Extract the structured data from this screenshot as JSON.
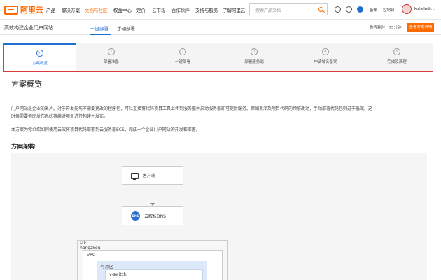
{
  "header": {
    "logo_text": "阿里云",
    "nav": [
      "产品",
      "解决方案",
      "文档与社区",
      "权益中心",
      "定价",
      "云市场",
      "合作伙伴",
      "支持与服务",
      "了解阿里云"
    ],
    "nav_active_index": 2,
    "search_placeholder": "搜索产品文档",
    "links": [
      "备案",
      "控制台"
    ],
    "username": "kohelp@..."
  },
  "subheader": {
    "title": "高效构建企业门户网站",
    "tabs": [
      "一键部署",
      "手动部署"
    ],
    "active_tab": 0,
    "time_label": "教程耗时：75分钟",
    "deploy_button": "查看方案详情"
  },
  "steps": [
    {
      "num": "✓",
      "label": "方案概览"
    },
    {
      "num": "1",
      "label": "部署准备"
    },
    {
      "num": "2",
      "label": "一键部署"
    },
    {
      "num": "3",
      "label": "部署服务端"
    },
    {
      "num": "4",
      "label": "申请域名备案"
    },
    {
      "num": "5",
      "label": "完成及清理"
    }
  ],
  "active_step": 0,
  "content": {
    "title": "方案概览",
    "para1_line1": "门户网站是企业的名片。对于开发先坊不需要更改的程序包，可以直接将代码项目工具上传到服务器并启动服务器即可提供服务。但如果涉及项目代码的频繁改动，手动部署代码包则过于低效。这",
    "para1_line2": "时候需要借助发布系统持续对项目进行构建并发布。",
    "para2": "本方案为你介绍如何使用云效将项目代码部署到云服务器ECS，完成一个企业门户网站的开发和部署。",
    "arch_title": "方案架构"
  },
  "diagram": {
    "client": "客户端",
    "dns": "云解析DNS",
    "dns_icon_text": "DNS",
    "region_line1": "cn-",
    "region_line2": "hangzhou",
    "vpc": "VPC",
    "zone": "可用区",
    "vswitch": "v-switch"
  },
  "colors": {
    "brand": "#ff6a00",
    "accent": "#1f6fd1",
    "highlight_border": "#d93a3a"
  }
}
